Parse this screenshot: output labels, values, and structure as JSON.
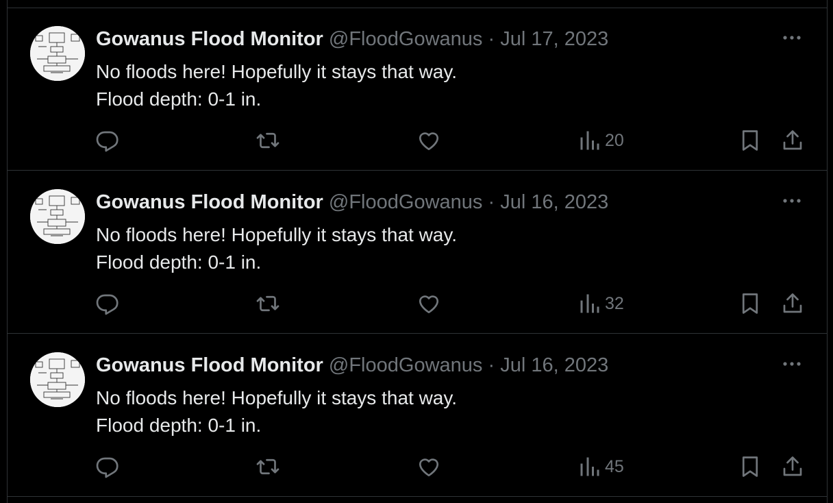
{
  "tweets": [
    {
      "author": "Gowanus Flood Monitor",
      "handle": "@FloodGowanus",
      "separator": "·",
      "date": "Jul 17, 2023",
      "line1": "No floods here! Hopefully it stays that way.",
      "line2": "Flood depth: 0-1 in.",
      "views": "20"
    },
    {
      "author": "Gowanus Flood Monitor",
      "handle": "@FloodGowanus",
      "separator": "·",
      "date": "Jul 16, 2023",
      "line1": "No floods here! Hopefully it stays that way.",
      "line2": "Flood depth: 0-1 in.",
      "views": "32"
    },
    {
      "author": "Gowanus Flood Monitor",
      "handle": "@FloodGowanus",
      "separator": "·",
      "date": "Jul 16, 2023",
      "line1": "No floods here! Hopefully it stays that way.",
      "line2": "Flood depth: 0-1 in.",
      "views": "45"
    }
  ],
  "icons": {
    "reply": "reply-icon",
    "retweet": "retweet-icon",
    "like": "like-icon",
    "views": "views-icon",
    "bookmark": "bookmark-icon",
    "share": "share-icon",
    "more": "more-icon"
  },
  "colors": {
    "background": "#000000",
    "text": "#e7e9ea",
    "secondary": "#71767b",
    "border": "#2f3336"
  }
}
